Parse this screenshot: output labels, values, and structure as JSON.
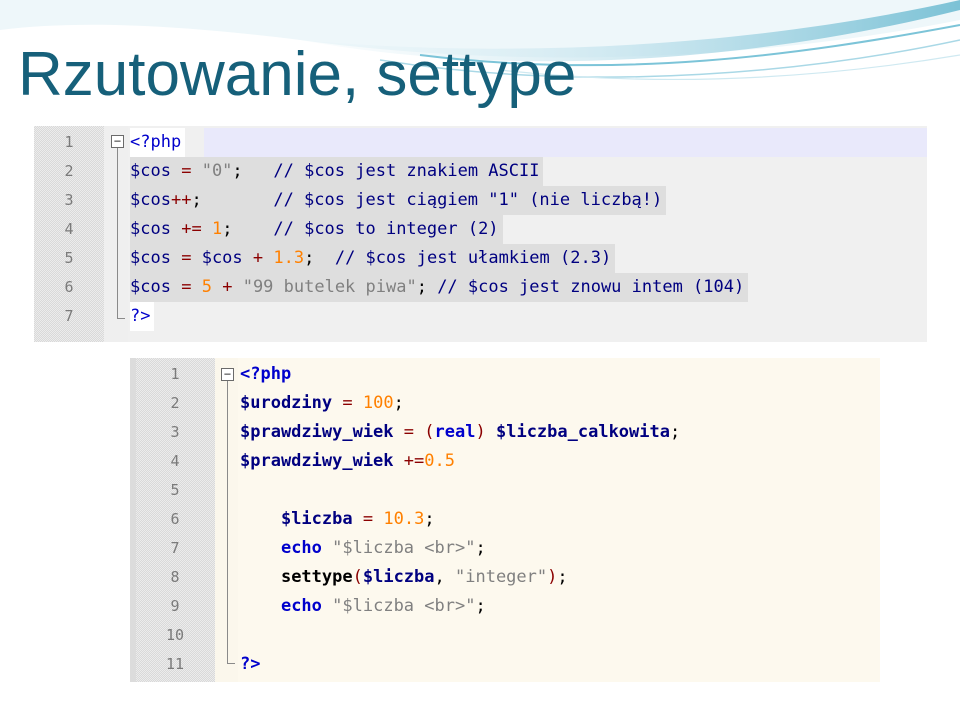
{
  "slide": {
    "title": "Rzutowanie, settype",
    "accent_color": "#16607a"
  },
  "snippet1": {
    "lines": [
      {
        "n": "1",
        "tokens": [
          [
            "kw",
            "<?php"
          ]
        ]
      },
      {
        "n": "2",
        "tokens": [
          [
            "var",
            "$cos"
          ],
          [
            "plain",
            " "
          ],
          [
            "op",
            "="
          ],
          [
            "plain",
            " "
          ],
          [
            "str",
            "\"0\""
          ],
          [
            "plain",
            ";   "
          ],
          [
            "cmt",
            "// $cos jest znakiem ASCII"
          ]
        ]
      },
      {
        "n": "3",
        "tokens": [
          [
            "var",
            "$cos"
          ],
          [
            "op",
            "++"
          ],
          [
            "plain",
            ";       "
          ],
          [
            "cmt",
            "// $cos jest ciągiem \"1\" (nie liczbą!)"
          ]
        ]
      },
      {
        "n": "4",
        "tokens": [
          [
            "var",
            "$cos"
          ],
          [
            "plain",
            " "
          ],
          [
            "op",
            "+="
          ],
          [
            "plain",
            " "
          ],
          [
            "num",
            "1"
          ],
          [
            "plain",
            ";    "
          ],
          [
            "cmt",
            "// $cos to integer (2)"
          ]
        ]
      },
      {
        "n": "5",
        "tokens": [
          [
            "var",
            "$cos"
          ],
          [
            "plain",
            " "
          ],
          [
            "op",
            "="
          ],
          [
            "plain",
            " "
          ],
          [
            "var",
            "$cos"
          ],
          [
            "plain",
            " "
          ],
          [
            "op",
            "+"
          ],
          [
            "plain",
            " "
          ],
          [
            "num",
            "1.3"
          ],
          [
            "plain",
            ";  "
          ],
          [
            "cmt",
            "// $cos jest ułamkiem (2.3)"
          ]
        ]
      },
      {
        "n": "6",
        "tokens": [
          [
            "var",
            "$cos"
          ],
          [
            "plain",
            " "
          ],
          [
            "op",
            "="
          ],
          [
            "plain",
            " "
          ],
          [
            "num",
            "5"
          ],
          [
            "plain",
            " "
          ],
          [
            "op",
            "+"
          ],
          [
            "plain",
            " "
          ],
          [
            "str",
            "\"99 butelek piwa\""
          ],
          [
            "plain",
            "; "
          ],
          [
            "cmt",
            "// $cos jest znowu intem (104)"
          ]
        ]
      },
      {
        "n": "7",
        "tokens": [
          [
            "kw",
            "?>"
          ]
        ]
      }
    ]
  },
  "snippet2": {
    "lines": [
      {
        "n": "1",
        "tokens": [
          [
            "kw",
            "<?php"
          ]
        ]
      },
      {
        "n": "2",
        "tokens": [
          [
            "var",
            "$urodziny"
          ],
          [
            "plain",
            " "
          ],
          [
            "op",
            "="
          ],
          [
            "plain",
            " "
          ],
          [
            "num",
            "100"
          ],
          [
            "plain",
            ";"
          ]
        ]
      },
      {
        "n": "3",
        "tokens": [
          [
            "var",
            "$prawdziwy_wiek"
          ],
          [
            "plain",
            " "
          ],
          [
            "op",
            "="
          ],
          [
            "plain",
            " "
          ],
          [
            "op",
            "("
          ],
          [
            "kw",
            "real"
          ],
          [
            "op",
            ")"
          ],
          [
            "plain",
            " "
          ],
          [
            "var",
            "$liczba_calkowita"
          ],
          [
            "plain",
            ";"
          ]
        ]
      },
      {
        "n": "4",
        "tokens": [
          [
            "var",
            "$prawdziwy_wiek"
          ],
          [
            "plain",
            " "
          ],
          [
            "op",
            "+="
          ],
          [
            "num",
            "0.5"
          ]
        ]
      },
      {
        "n": "5",
        "tokens": []
      },
      {
        "n": "6",
        "tokens": [
          [
            "plain",
            "    "
          ],
          [
            "var",
            "$liczba"
          ],
          [
            "plain",
            " "
          ],
          [
            "op",
            "="
          ],
          [
            "plain",
            " "
          ],
          [
            "num",
            "10.3"
          ],
          [
            "plain",
            ";"
          ]
        ]
      },
      {
        "n": "7",
        "tokens": [
          [
            "plain",
            "    "
          ],
          [
            "kw",
            "echo"
          ],
          [
            "plain",
            " "
          ],
          [
            "str",
            "\"$liczba <br>\""
          ],
          [
            "plain",
            ";"
          ]
        ]
      },
      {
        "n": "8",
        "tokens": [
          [
            "plain",
            "    "
          ],
          [
            "fn",
            "settype"
          ],
          [
            "op",
            "("
          ],
          [
            "var",
            "$liczba"
          ],
          [
            "plain",
            ", "
          ],
          [
            "str",
            "\"integer\""
          ],
          [
            "op",
            ")"
          ],
          [
            "plain",
            ";"
          ]
        ]
      },
      {
        "n": "9",
        "tokens": [
          [
            "plain",
            "    "
          ],
          [
            "kw",
            "echo"
          ],
          [
            "plain",
            " "
          ],
          [
            "str",
            "\"$liczba <br>\""
          ],
          [
            "plain",
            ";"
          ]
        ]
      },
      {
        "n": "10",
        "tokens": []
      },
      {
        "n": "11",
        "tokens": [
          [
            "kw",
            "?>"
          ]
        ]
      }
    ]
  }
}
